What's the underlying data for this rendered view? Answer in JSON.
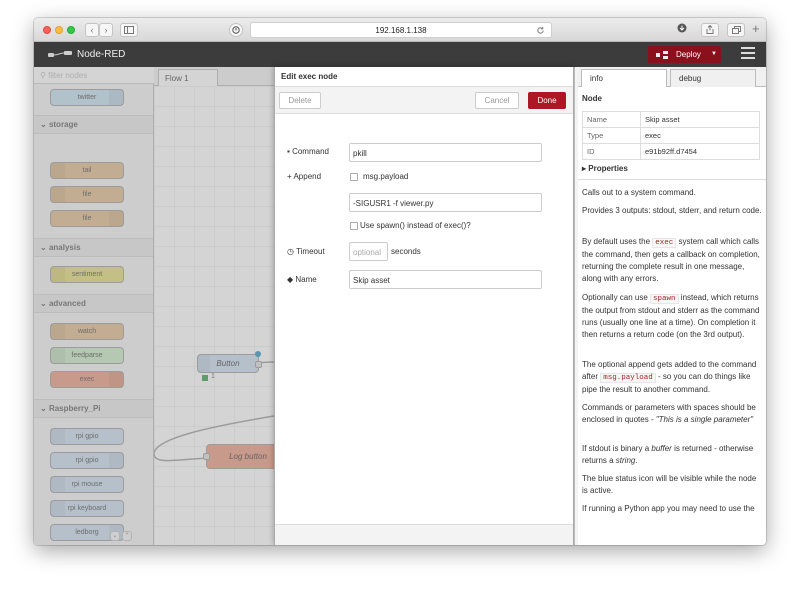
{
  "browser": {
    "url": "192.168.1.138",
    "nav_back": "‹",
    "nav_fwd": "›"
  },
  "header": {
    "title": "Node-RED",
    "deploy_label": "Deploy"
  },
  "palette": {
    "filter_placeholder": "filter nodes",
    "categories": [
      {
        "label": "storage"
      },
      {
        "label": "analysis"
      },
      {
        "label": "advanced"
      },
      {
        "label": "Raspberry_Pi"
      }
    ],
    "nodes": [
      {
        "label": "twitter",
        "color": "#c0deed"
      },
      {
        "label": "tail",
        "color": "#deb887"
      },
      {
        "label": "file",
        "color": "#deb887"
      },
      {
        "label": "file",
        "color": "#deb887"
      },
      {
        "label": "sentiment",
        "color": "#e2d96e"
      },
      {
        "label": "watch",
        "color": "#deb887"
      },
      {
        "label": "feedparse",
        "color": "#c7e9c0"
      },
      {
        "label": "exec",
        "color": "#e9967a"
      },
      {
        "label": "rpi gpio",
        "color": "#c6dbef"
      },
      {
        "label": "rpi gpio",
        "color": "#c6dbef"
      },
      {
        "label": "rpi mouse",
        "color": "#c6dbef"
      },
      {
        "label": "rpi keyboard",
        "color": "#c6dbef"
      },
      {
        "label": "ledborg",
        "color": "#c6dbef"
      }
    ]
  },
  "workspace": {
    "tab_label": "Flow 1",
    "nodes": [
      {
        "label": "Button",
        "color": "#c6dbef"
      },
      {
        "label": "Log button",
        "color": "#e9967a"
      }
    ],
    "status_count": "1"
  },
  "tray": {
    "title": "Edit exec node",
    "delete_label": "Delete",
    "cancel_label": "Cancel",
    "done_label": "Done",
    "command_label": "Command",
    "command_value": "pkill",
    "append_label": "Append",
    "append_checkbox_label": "msg.payload",
    "append_extra_value": "-SIGUSR1 -f viewer.py",
    "spawn_label": "Use spawn() instead of exec()?",
    "timeout_label": "Timeout",
    "timeout_placeholder": "optional",
    "timeout_unit": "seconds",
    "name_label": "Name",
    "name_value": "Skip asset"
  },
  "sidebar": {
    "tab_info": "info",
    "tab_debug": "debug",
    "node_heading": "Node",
    "rows": [
      {
        "key": "Name",
        "value": "Skip asset"
      },
      {
        "key": "Type",
        "value": "exec"
      },
      {
        "key": "ID",
        "value": "e91b92ff.d7454"
      }
    ],
    "properties_label": "Properties",
    "p1": "Calls out to a system command.",
    "p2": "Provides 3 outputs: stdout, stderr, and return code.",
    "p3_a": "By default uses the ",
    "p3_code": "exec",
    "p3_b": " system call which calls the command, then gets a callback on completion, returning the complete result in one message, along with any errors.",
    "p4_a": "Optionally can use ",
    "p4_code": "spawn",
    "p4_b": " instead, which returns the output from stdout and stderr as the command runs (usually one line at a time). On completion it then returns a return code (on the 3rd output).",
    "p5_a": "The optional append gets added to the command after ",
    "p5_code": "msg.payload",
    "p5_b": " - so you can do things like pipe the result to another command.",
    "p6_a": "Commands or parameters with spaces should be enclosed in quotes - ",
    "p6_em": "\"This is a single parameter\"",
    "p7_a": "If stdout is binary a ",
    "p7_em1": "buffer",
    "p7_b": " is returned - otherwise returns a ",
    "p7_em2": "string",
    "p7_c": ".",
    "p8": "The blue status icon will be visible while the node is active.",
    "p9": "If running a Python app you may need to use the"
  }
}
